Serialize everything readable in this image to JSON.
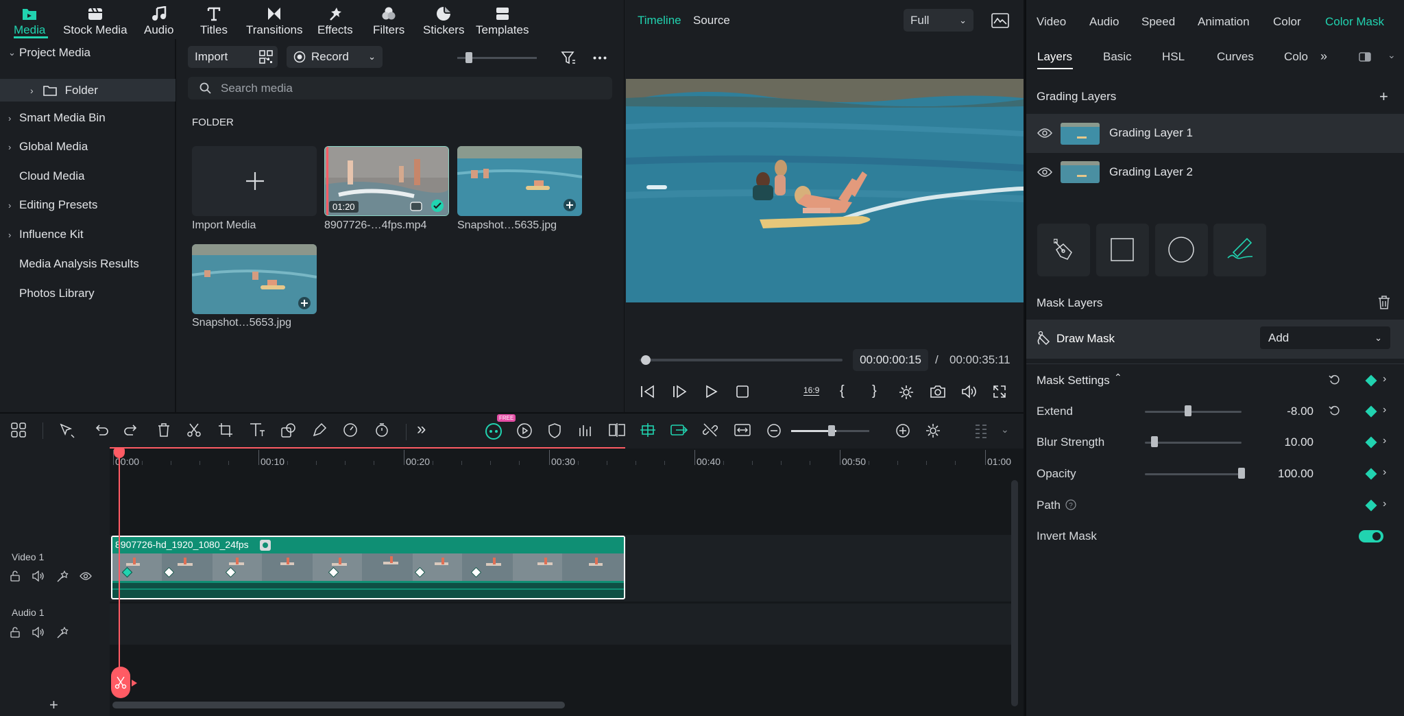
{
  "toolbar": {
    "tabs": [
      {
        "label": "Media",
        "icon": "media-folder-icon"
      },
      {
        "label": "Stock Media",
        "icon": "stock-media-icon"
      },
      {
        "label": "Audio",
        "icon": "music-note-icon"
      },
      {
        "label": "Titles",
        "icon": "titles-t-icon"
      },
      {
        "label": "Transitions",
        "icon": "transitions-icon"
      },
      {
        "label": "Effects",
        "icon": "effects-icon"
      },
      {
        "label": "Filters",
        "icon": "filters-icon"
      },
      {
        "label": "Stickers",
        "icon": "stickers-icon"
      },
      {
        "label": "Templates",
        "icon": "templates-icon"
      }
    ],
    "active": "Media"
  },
  "sidebar": {
    "items": [
      {
        "label": "Project Media",
        "expanded": true
      },
      {
        "label": "Folder",
        "selected": true
      },
      {
        "label": "Smart Media Bin"
      },
      {
        "label": "Global Media"
      },
      {
        "label": "Cloud Media"
      },
      {
        "label": "Editing Presets"
      },
      {
        "label": "Influence Kit"
      },
      {
        "label": "Media Analysis Results"
      },
      {
        "label": "Photos Library"
      }
    ]
  },
  "media": {
    "import_label": "Import",
    "record_label": "Record",
    "search_placeholder": "Search media",
    "section_title": "FOLDER",
    "items": [
      {
        "label": "Import Media",
        "type": "import"
      },
      {
        "label": "8907726-…4fps.mp4",
        "duration": "01:20",
        "type": "video"
      },
      {
        "label": "Snapshot…5635.jpg",
        "type": "image"
      },
      {
        "label": "Snapshot…5653.jpg",
        "type": "image"
      }
    ]
  },
  "preview": {
    "tabs": [
      "Timeline",
      "Source"
    ],
    "active_tab": "Timeline",
    "quality": "Full",
    "current_time": "00:00:00:15",
    "separator": "/",
    "total_time": "00:00:35:11",
    "aspect": "16:9"
  },
  "inspector": {
    "tabs": [
      "Video",
      "Audio",
      "Speed",
      "Animation",
      "Color",
      "Color Mask"
    ],
    "active_tab": "Color Mask",
    "subtabs": [
      "Layers",
      "Basic",
      "HSL",
      "Curves",
      "Colo"
    ],
    "active_subtab": "Layers",
    "grading_title": "Grading Layers",
    "grading_layers": [
      "Grading Layer 1",
      "Grading Layer 2"
    ],
    "mask_layers_title": "Mask Layers",
    "draw_mask_label": "Draw Mask",
    "draw_mask_mode": "Add",
    "mask_settings_title": "Mask Settings",
    "settings": [
      {
        "label": "Extend",
        "value": "-8.00",
        "level": 0.45
      },
      {
        "label": "Blur Strength",
        "value": "10.00",
        "level": 0.1
      },
      {
        "label": "Opacity",
        "value": "100.00",
        "level": 1.0
      },
      {
        "label": "Path"
      },
      {
        "label": "Invert Mask",
        "toggle": true
      }
    ],
    "accent": "#21d3b0"
  },
  "timeline": {
    "ruler": [
      "00:00",
      "00:10",
      "00:20",
      "00:30",
      "00:40",
      "00:50",
      "01:00"
    ],
    "tracks": [
      {
        "name": "Video 1"
      },
      {
        "name": "Audio 1"
      }
    ],
    "clip_name": "8907726-hd_1920_1080_24fps",
    "playhead_color": "#ff5b64",
    "clip_color": "#0f8f74",
    "free_badge": "FREE"
  }
}
